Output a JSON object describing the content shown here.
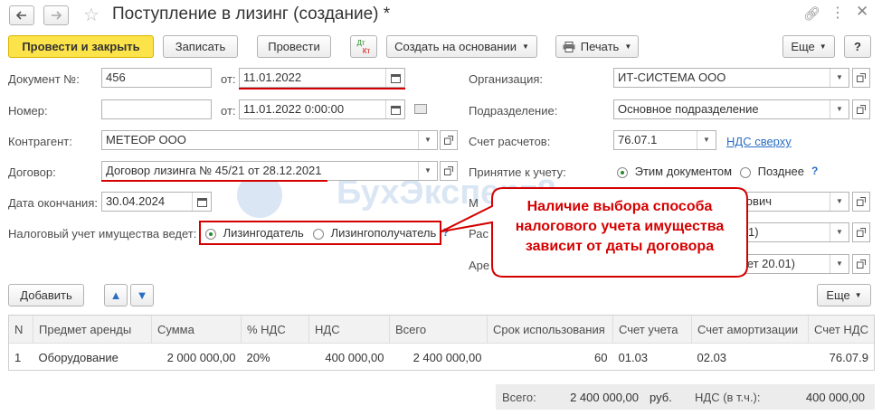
{
  "window": {
    "title": "Поступление в лизинг (создание) *"
  },
  "toolbar": {
    "post_close": "Провести и закрыть",
    "save": "Записать",
    "post": "Провести",
    "dt_kt_top": "Дт",
    "dt_kt_bottom": "Кт",
    "create_based": "Создать на основании",
    "print": "Печать",
    "more": "Еще",
    "help": "?"
  },
  "form": {
    "doc_no_label": "Документ №:",
    "doc_no": "456",
    "from_label": "от:",
    "doc_date": "11.01.2022",
    "number_label": "Номер:",
    "number": "",
    "from_label2": "от:",
    "number_date": "11.01.2022  0:00:00",
    "counterparty_label": "Контрагент:",
    "counterparty": "МЕТЕОР ООО",
    "contract_label": "Договор:",
    "contract": "Договор лизинга № 45/21 от 28.12.2021",
    "end_date_label": "Дата окончания:",
    "end_date": "30.04.2024",
    "tax_label": "Налоговый учет имущества ведет:",
    "tax_opt1": "Лизингодатель",
    "tax_opt2": "Лизингополучатель",
    "org_label": "Организация:",
    "org": "ИТ-СИСТЕМА ООО",
    "dept_label": "Подразделение:",
    "dept": "Основное подразделение",
    "account_label": "Счет расчетов:",
    "account": "76.07.1",
    "vat_link": "НДС сверху",
    "accept_label": "Принятие к учету:",
    "accept_opt1": "Этим документом",
    "accept_opt2": "Позднее",
    "row5_label": "М",
    "row5_value": "тович",
    "row6_label": "Рас",
    "row6_value": "1)",
    "row7_label": "Аре",
    "row7_value": "чет 20.01)"
  },
  "watermark": "БухЭксперт8",
  "callout": {
    "text": "Наличие выбора способа налогового учета имущества зависит от даты договора"
  },
  "table_toolbar": {
    "add": "Добавить",
    "more": "Еще"
  },
  "table": {
    "headers": [
      "N",
      "Предмет аренды",
      "Сумма",
      "% НДС",
      "НДС",
      "Всего",
      "Срок использования",
      "Счет учета",
      "Счет амортизации",
      "Счет НДС"
    ],
    "rows": [
      [
        "1",
        "Оборудование",
        "2 000 000,00",
        "20%",
        "400 000,00",
        "2 400 000,00",
        "60",
        "01.03",
        "02.03",
        "76.07.9"
      ]
    ]
  },
  "totals": {
    "total_label": "Всего:",
    "total_value": "2 400 000,00",
    "currency": "руб.",
    "vat_label": "НДС (в т.ч.):",
    "vat_value": "400 000,00"
  },
  "colors": {
    "primary_button": "#fce349",
    "highlight_red": "#d40000",
    "link_blue": "#2a6ec4"
  }
}
